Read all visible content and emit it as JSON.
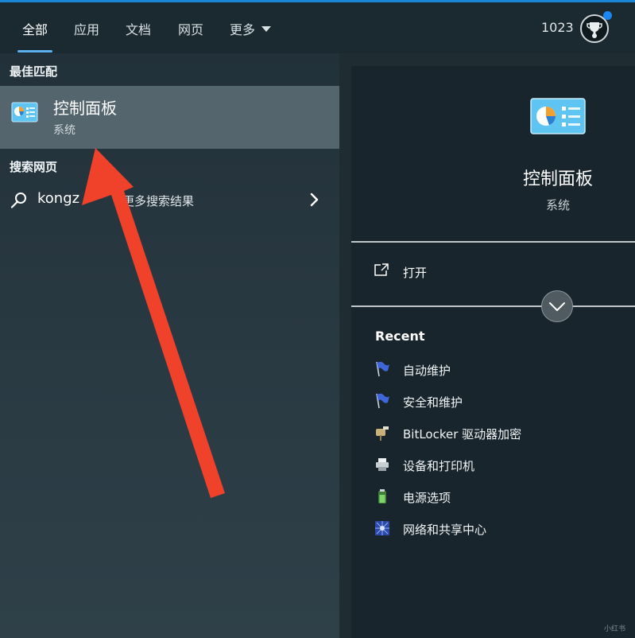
{
  "tabs": [
    {
      "label": "全部"
    },
    {
      "label": "应用"
    },
    {
      "label": "文档"
    },
    {
      "label": "网页"
    },
    {
      "label": "更多"
    }
  ],
  "header": {
    "points": "1023"
  },
  "left": {
    "best_match_title": "最佳匹配",
    "best_match": {
      "title": "控制面板",
      "subtitle": "系统",
      "icon": "control-panel-icon"
    },
    "search_web_title": "搜索网页",
    "web_query": "kongz",
    "web_suffix": "更多搜索结果"
  },
  "right": {
    "title": "控制面板",
    "subtitle": "系统",
    "open_label": "打开",
    "recent_title": "Recent",
    "recent": [
      {
        "label": "自动维护",
        "icon": "flag-icon"
      },
      {
        "label": "安全和维护",
        "icon": "flag-icon"
      },
      {
        "label": "BitLocker 驱动器加密",
        "icon": "bitlocker-key-icon"
      },
      {
        "label": "设备和打印机",
        "icon": "printer-icon"
      },
      {
        "label": "电源选项",
        "icon": "battery-icon"
      },
      {
        "label": "网络和共享中心",
        "icon": "network-icon"
      }
    ]
  },
  "colors": {
    "accent": "#1a86d6",
    "selected": "#54656d",
    "arrow": "#f0412b"
  }
}
